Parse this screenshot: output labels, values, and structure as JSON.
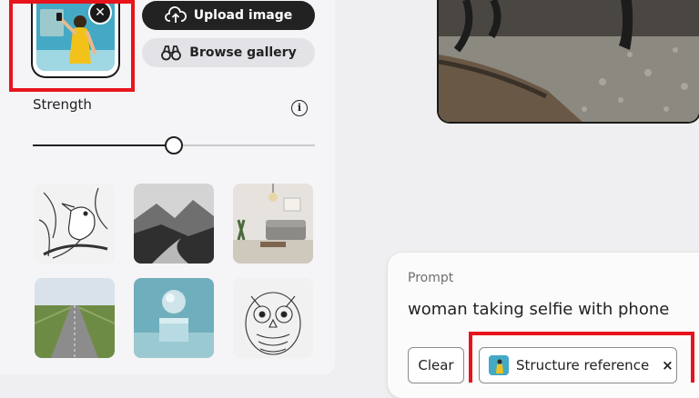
{
  "reference": {
    "remove_symbol": "✕"
  },
  "actions": {
    "upload_label": "Upload image",
    "browse_label": "Browse gallery"
  },
  "strength": {
    "label": "Strength",
    "info_symbol": "i",
    "value_fraction": 0.5
  },
  "styles": [
    {
      "name": "bird-sketch"
    },
    {
      "name": "mountain-valley"
    },
    {
      "name": "living-room"
    },
    {
      "name": "road-field"
    },
    {
      "name": "sphere-3d"
    },
    {
      "name": "owl-sketch"
    }
  ],
  "prompt": {
    "label": "Prompt",
    "text": "woman taking selfie with phone",
    "clear_label": "Clear",
    "chip_label": "Structure reference",
    "chip_close": "×"
  },
  "colors": {
    "highlight": "#e8141c",
    "dark_button": "#222222",
    "light_button": "#e3e2e6"
  },
  "icons": [
    "remove-icon",
    "cloud-upload-icon",
    "binoculars-icon",
    "info-icon",
    "close-icon"
  ]
}
